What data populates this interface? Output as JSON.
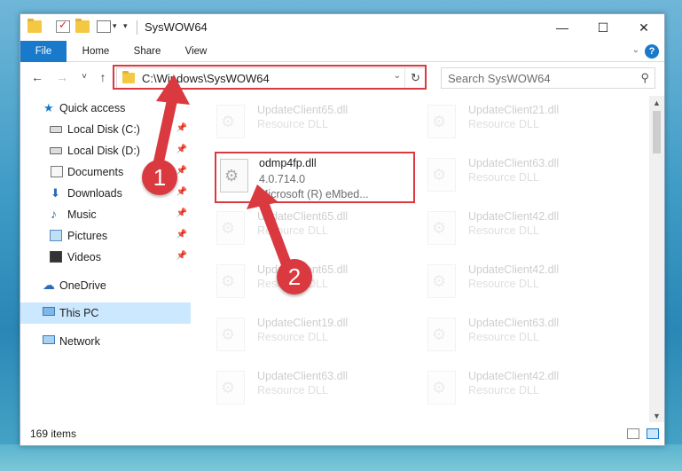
{
  "window": {
    "title": "SysWOW64",
    "controls": {
      "minimize": "—",
      "maximize": "☐",
      "close": "✕"
    }
  },
  "ribbon": {
    "tabs": [
      "File",
      "Home",
      "Share",
      "View"
    ],
    "help": "?"
  },
  "nav": {
    "back": "←",
    "forward": "→",
    "recent": "˅",
    "up": "↑",
    "address": "C:\\Windows\\SysWOW64",
    "refresh": "↻",
    "search_placeholder": "Search SysWOW64"
  },
  "sidebar": {
    "items": [
      {
        "label": "Quick access",
        "icon": "star-icon",
        "pinned": false
      },
      {
        "label": "Local Disk (C:)",
        "icon": "drive-icon",
        "pinned": true
      },
      {
        "label": "Local Disk (D:)",
        "icon": "drive-icon",
        "pinned": true
      },
      {
        "label": "Documents",
        "icon": "documents-icon",
        "pinned": true
      },
      {
        "label": "Downloads",
        "icon": "download-icon",
        "pinned": true
      },
      {
        "label": "Music",
        "icon": "music-icon",
        "pinned": true
      },
      {
        "label": "Pictures",
        "icon": "pictures-icon",
        "pinned": true
      },
      {
        "label": "Videos",
        "icon": "videos-icon",
        "pinned": true
      },
      {
        "label": "OneDrive",
        "icon": "onedrive-icon",
        "pinned": false
      },
      {
        "label": "This PC",
        "icon": "this-pc-icon",
        "pinned": false,
        "selected": true
      },
      {
        "label": "Network",
        "icon": "network-icon",
        "pinned": false
      }
    ]
  },
  "files": {
    "left": [
      {
        "name": "UpdateClient65.dll",
        "type": "Resource DLL"
      },
      {
        "name": "odmp4fp.dll",
        "version": "4.0.714.0",
        "description": "Microsoft (R) eMbed..."
      },
      {
        "name": "UpdateClient65.dll",
        "type": "Resource DLL"
      },
      {
        "name": "UpdateClient65.dll",
        "type": "Resource DLL"
      },
      {
        "name": "UpdateClient19.dll",
        "type": "Resource DLL"
      },
      {
        "name": "UpdateClient63.dll",
        "type": "Resource DLL"
      }
    ],
    "right": [
      {
        "name": "UpdateClient21.dll",
        "type": "Resource DLL"
      },
      {
        "name": "UpdateClient63.dll",
        "type": "Resource DLL"
      },
      {
        "name": "UpdateClient42.dll",
        "type": "Resource DLL"
      },
      {
        "name": "UpdateClient42.dll",
        "type": "Resource DLL"
      },
      {
        "name": "UpdateClient63.dll",
        "type": "Resource DLL"
      },
      {
        "name": "UpdateClient42.dll",
        "type": "Resource DLL"
      }
    ]
  },
  "status": {
    "item_count": "169 items"
  },
  "annotations": {
    "step1": "1",
    "step2": "2",
    "color": "#d9393f"
  }
}
